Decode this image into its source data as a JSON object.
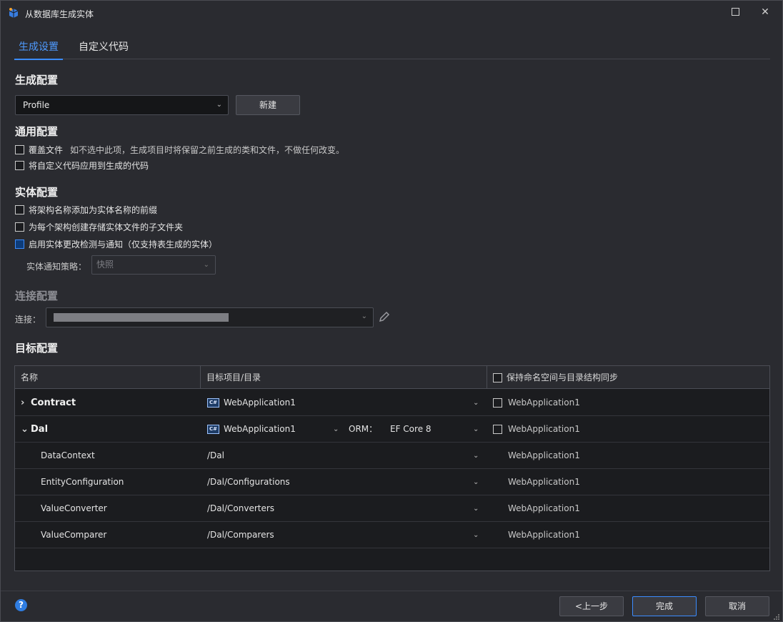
{
  "window": {
    "title": "从数据库生成实体"
  },
  "tabs": [
    {
      "label": "生成设置",
      "active": true
    },
    {
      "label": "自定义代码",
      "active": false
    }
  ],
  "profile": {
    "section_title": "生成配置",
    "selected": "Profile",
    "new_button": "新建"
  },
  "general": {
    "section_title": "通用配置",
    "overwrite_label": "覆盖文件",
    "overwrite_hint": "如不选中此项，生成项目时将保留之前生成的类和文件，不做任何改变。",
    "overwrite_checked": false,
    "apply_custom_label": "将自定义代码应用到生成的代码",
    "apply_custom_checked": false
  },
  "entity": {
    "section_title": "实体配置",
    "schema_prefix_label": "将架构名称添加为实体名称的前缀",
    "schema_subfolder_label": "为每个架构创建存储实体文件的子文件夹",
    "change_detection_label": "启用实体更改检测与通知（仅支持表生成的实体）",
    "change_detection_checked": false,
    "notify_strategy_label": "实体通知策略：",
    "notify_strategy_value": "快照"
  },
  "connection": {
    "section_title": "连接配置",
    "label": "连接："
  },
  "target": {
    "section_title": "目标配置",
    "columns": {
      "name": "名称",
      "target": "目标项目/目录",
      "sync_ns": "保持命名空间与目录结构同步"
    },
    "rows": [
      {
        "name": "Contract",
        "group": true,
        "expanded": false,
        "target": "WebApplication1",
        "project_icon": true,
        "namespace": "WebApplication1",
        "ns_checkbox": true
      },
      {
        "name": "Dal",
        "group": true,
        "expanded": true,
        "target": "WebApplication1",
        "project_icon": true,
        "orm_label": "ORM：",
        "orm_value": "EF Core 8",
        "namespace": "WebApplication1",
        "ns_checkbox": true
      },
      {
        "name": "DataContext",
        "group": false,
        "target": "/Dal",
        "namespace": "WebApplication1"
      },
      {
        "name": "EntityConfiguration",
        "group": false,
        "target": "/Dal/Configurations",
        "namespace": "WebApplication1"
      },
      {
        "name": "ValueConverter",
        "group": false,
        "target": "/Dal/Converters",
        "namespace": "WebApplication1"
      },
      {
        "name": "ValueComparer",
        "group": false,
        "target": "/Dal/Comparers",
        "namespace": "WebApplication1"
      }
    ]
  },
  "footer": {
    "prev_button": "<上一步",
    "finish_button": "完成",
    "cancel_button": "取消"
  },
  "colors": {
    "accent": "#3b8cff",
    "background": "#2a2b30",
    "grid": "#1b1c1f"
  }
}
